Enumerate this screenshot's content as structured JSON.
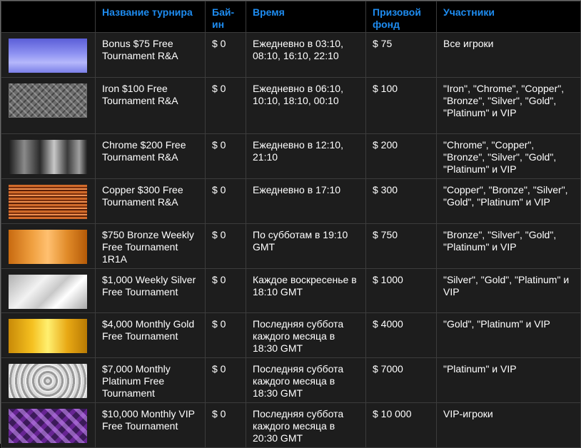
{
  "headers": {
    "name": "Название турнира",
    "buyin": "Бай-ин",
    "time": "Время",
    "prize": "Призовой фонд",
    "players": "Участники"
  },
  "rows": [
    {
      "thumb": "bonus-texture",
      "name": "Bonus $75 Free Tournament R&A",
      "buyin": "$ 0",
      "time": "Ежедневно в 03:10, 08:10, 16:10, 22:10",
      "prize": "$ 75",
      "players": "Все игроки"
    },
    {
      "thumb": "iron-texture",
      "name": "Iron $100 Free Tournament R&A",
      "buyin": "$ 0",
      "time": "Ежедневно в 06:10, 10:10, 18:10, 00:10",
      "prize": "$ 100",
      "players": "\"Iron\", \"Chrome\", \"Copper\", \"Bronze\", \"Silver\", \"Gold\", \"Platinum\" и VIP"
    },
    {
      "thumb": "chrome-texture",
      "name": "Chrome $200 Free Tournament R&A",
      "buyin": "$ 0",
      "time": "Ежедневно в 12:10, 21:10",
      "prize": "$ 200",
      "players": "\"Chrome\", \"Copper\", \"Bronze\", \"Silver\", \"Gold\", \"Platinum\" и VIP"
    },
    {
      "thumb": "copper-texture",
      "name": "Copper $300 Free Tournament R&A",
      "buyin": "$ 0",
      "time": "Ежедневно в 17:10",
      "prize": "$ 300",
      "players": "\"Copper\", \"Bronze\", \"Silver\", \"Gold\", \"Platinum\" и VIP"
    },
    {
      "thumb": "bronze-texture",
      "name": "$750 Bronze Weekly Free Tournament 1R1A",
      "buyin": "$ 0",
      "time": "По субботам в 19:10 GMT",
      "prize": "$ 750",
      "players": "\"Bronze\", \"Silver\", \"Gold\", \"Platinum\" и VIP"
    },
    {
      "thumb": "silver-texture",
      "name": "$1,000 Weekly Silver Free Tournament",
      "buyin": "$ 0",
      "time": "Каждое воскресенье в 18:10 GMT",
      "prize": "$ 1000",
      "players": "\"Silver\", \"Gold\", \"Platinum\" и VIP"
    },
    {
      "thumb": "gold-texture",
      "name": "$4,000 Monthly Gold Free Tournament",
      "buyin": "$ 0",
      "time": "Последняя суббота каждого месяца в 18:30 GMT",
      "prize": "$ 4000",
      "players": "\"Gold\", \"Platinum\" и VIP"
    },
    {
      "thumb": "platinum-texture",
      "name": "$7,000 Monthly Platinum Free Tournament",
      "buyin": "$ 0",
      "time": "Последняя суббота каждого месяца в 18:30 GMT",
      "prize": "$ 7000",
      "players": "\"Platinum\" и VIP"
    },
    {
      "thumb": "vip-texture",
      "name": "$10,000 Monthly VIP Free Tournament",
      "buyin": "$ 0",
      "time": "Последняя суббота каждого месяца в 20:30 GMT",
      "prize": "$ 10 000",
      "players": "VIP-игроки"
    }
  ],
  "colors": {
    "header_text": "#1e8cf0",
    "header_bg": "#000000",
    "row_bg": "#1d1d1d",
    "cell_text": "#ffffff"
  }
}
